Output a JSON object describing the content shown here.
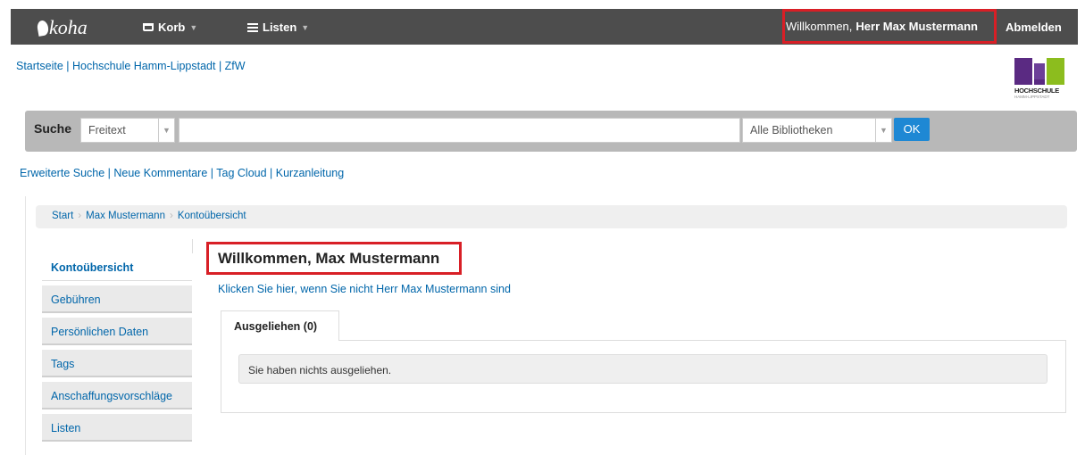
{
  "navbar": {
    "logo_text": "koha",
    "cart_label": "Korb",
    "lists_label": "Listen",
    "welcome_prefix": "Willkommen,",
    "welcome_name": "Herr Max Mustermann",
    "logout_label": "Abmelden"
  },
  "header": {
    "breadcrumb_text": "Startseite | Hochschule Hamm-Lippstadt | ZfW",
    "institution_logo_text": "HOCHSCHULE",
    "institution_logo_subtext": "HAMM-LIPPSTADT"
  },
  "search": {
    "label": "Suche",
    "scope_selected": "Freitext",
    "query_value": "",
    "library_selected": "Alle Bibliotheken",
    "submit_label": "OK"
  },
  "links": {
    "text": "Erweiterte Suche | Neue Kommentare | Tag Cloud | Kurzanleitung"
  },
  "breadcrumb": [
    "Start",
    "Max Mustermann",
    "Kontoübersicht"
  ],
  "sidebar": {
    "items": [
      {
        "label": "Kontoübersicht",
        "active": true
      },
      {
        "label": "Gebühren"
      },
      {
        "label": "Persönlichen Daten"
      },
      {
        "label": "Tags"
      },
      {
        "label": "Anschaffungsvorschläge"
      },
      {
        "label": "Listen"
      }
    ]
  },
  "main": {
    "title": "Willkommen, Max Mustermann",
    "switch_user_link": "Klicken Sie hier, wenn Sie nicht Herr Max Mustermann sind",
    "tab_label": "Ausgeliehen (0)",
    "notice": "Sie haben nichts ausgeliehen."
  },
  "colors": {
    "highlight_border": "#d81f26",
    "link": "#0066aa",
    "navbar_bg": "#4d4d4d",
    "ok_button": "#1e88d4"
  }
}
